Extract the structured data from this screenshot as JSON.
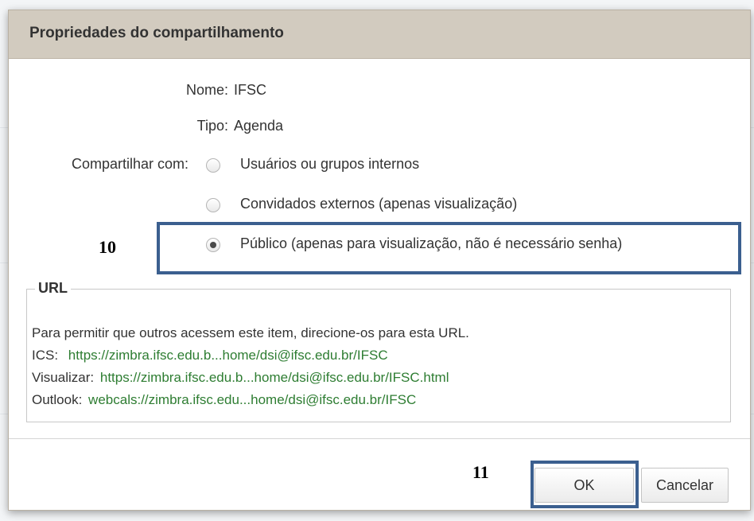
{
  "dialog": {
    "title": "Propriedades do compartilhamento"
  },
  "fields": {
    "name_label": "Nome:",
    "name_value": "IFSC",
    "type_label": "Tipo:",
    "type_value": "Agenda",
    "share_with_label": "Compartilhar com:"
  },
  "share_options": [
    {
      "label": "Usuários ou grupos internos",
      "selected": false
    },
    {
      "label": "Convidados externos (apenas visualização)",
      "selected": false
    },
    {
      "label": "Público (apenas para visualização, não é necessário senha)",
      "selected": true
    }
  ],
  "url_section": {
    "legend": "URL",
    "intro": "Para permitir que outros acessem este item, direcione-os para esta URL.",
    "ics_label": "ICS:",
    "ics_value": "https://zimbra.ifsc.edu.b...home/dsi@ifsc.edu.br/IFSC",
    "view_label": "Visualizar:",
    "view_value": "https://zimbra.ifsc.edu.b...home/dsi@ifsc.edu.br/IFSC.html",
    "outlook_label": "Outlook:",
    "outlook_value": "webcals://zimbra.ifsc.edu...home/dsi@ifsc.edu.br/IFSC"
  },
  "buttons": {
    "ok": "OK",
    "cancel": "Cancelar"
  },
  "annotations": {
    "step_public": "10",
    "step_ok": "11"
  },
  "colors": {
    "titlebar": "#d2cbbf",
    "link": "#2e7d32",
    "highlight": "#3b5f8f"
  }
}
